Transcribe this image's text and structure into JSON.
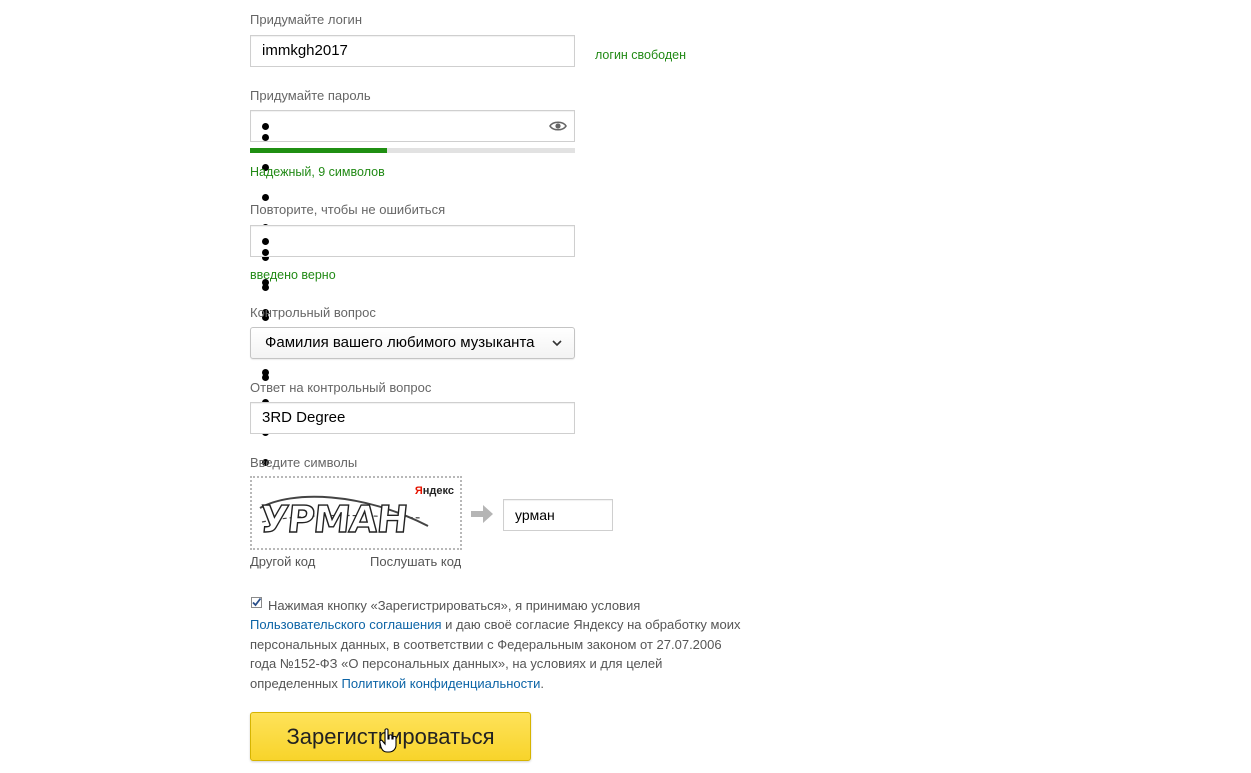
{
  "login": {
    "label": "Придумайте логин",
    "value": "immkgh2017",
    "status": "логин свободен"
  },
  "password": {
    "label": "Придумайте пароль",
    "masked_length": 9,
    "strength_fraction": 0.42,
    "strength_text": "Надежный, 9 символов",
    "show_icon": "eye-icon"
  },
  "password_repeat": {
    "label": "Повторите, чтобы не ошибиться",
    "masked_length": 9,
    "status": "введено верно"
  },
  "security_question": {
    "label": "Контрольный вопрос",
    "selected": "Фамилия вашего любимого музыканта"
  },
  "security_answer": {
    "label": "Ответ на контрольный вопрос",
    "value": "3RD Degree"
  },
  "captcha": {
    "label": "Введите символы",
    "image_text": "УРМАН",
    "brand": "Яндекс",
    "other_code": "Другой код",
    "listen_code": "Послушать код",
    "input_value": "урман",
    "arrow_icon": "arrow-right-icon"
  },
  "agreement": {
    "checked": true,
    "text_1": "Нажимая кнопку «Зарегистрироваться», я принимаю условия",
    "link_1": "Пользовательского соглашения",
    "text_2": " и даю своё согласие Яндексу на обработку моих",
    "line_3": "персональных данных, в соответствии с Федеральным законом от 27.07.2006",
    "line_4": "года №152-ФЗ «О персональных данных», на условиях и для целей",
    "text_5": "определенных ",
    "link_2": "Политикой конфиденциальности",
    "text_6": "."
  },
  "submit": {
    "label": "Зарегистрироваться"
  },
  "colors": {
    "success": "#228a16",
    "link": "#0c64a6",
    "button": "#fcdb46"
  }
}
